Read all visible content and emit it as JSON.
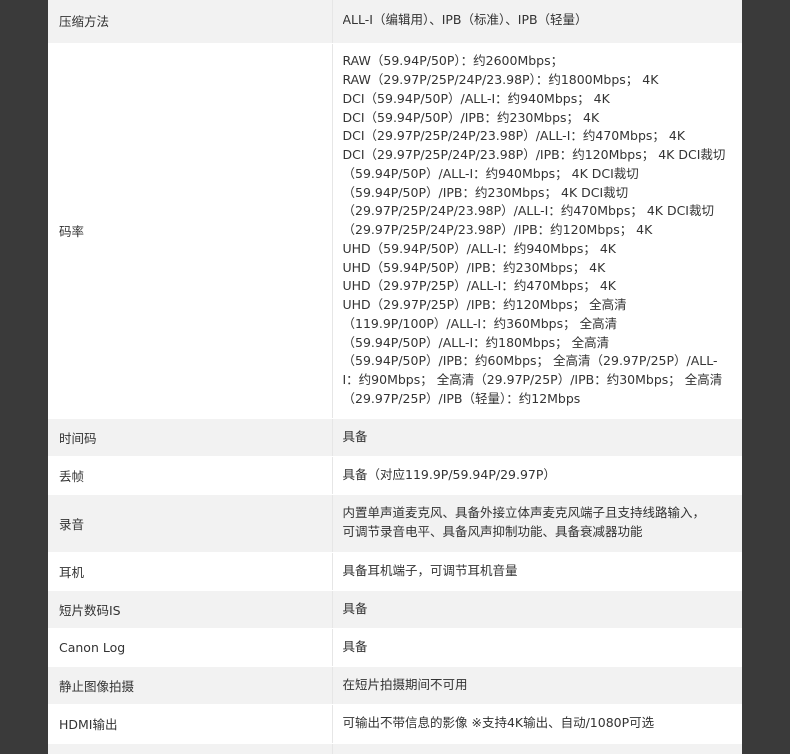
{
  "rows": [
    {
      "label": "压缩方法",
      "lines": [
        "ALL-I（编辑用）、IPB（标准）、IPB（轻量）"
      ]
    },
    {
      "label": "码率",
      "lines": [
        "RAW（59.94P/50P）：约2600Mbps；",
        "RAW（29.97P/25P/24P/23.98P）：约1800Mbps； 4K",
        "DCI（59.94P/50P）/ALL-I：约940Mbps； 4K",
        "DCI（59.94P/50P）/IPB：约230Mbps； 4K",
        "DCI（29.97P/25P/24P/23.98P）/ALL-I：约470Mbps； 4K",
        "DCI（29.97P/25P/24P/23.98P）/IPB：约120Mbps； 4K DCI裁切",
        "（59.94P/50P）/ALL-I：约940Mbps； 4K DCI裁切",
        "（59.94P/50P）/IPB：约230Mbps； 4K DCI裁切",
        "（29.97P/25P/24P/23.98P）/ALL-I：约470Mbps； 4K DCI裁切",
        "（29.97P/25P/24P/23.98P）/IPB：约120Mbps； 4K",
        "UHD（59.94P/50P）/ALL-I：约940Mbps； 4K",
        "UHD（59.94P/50P）/IPB：约230Mbps； 4K",
        "UHD（29.97P/25P）/ALL-I：约470Mbps； 4K",
        "UHD（29.97P/25P）/IPB：约120Mbps； 全高清",
        "（119.9P/100P）/ALL-I：约360Mbps； 全高清",
        "（59.94P/50P）/ALL-I：约180Mbps； 全高清",
        "（59.94P/50P）/IPB：约60Mbps； 全高清（29.97P/25P）/ALL-",
        "I：约90Mbps； 全高清（29.97P/25P）/IPB：约30Mbps； 全高清",
        "（29.97P/25P）/IPB（轻量）：约12Mbps"
      ]
    },
    {
      "label": "时间码",
      "lines": [
        "具备"
      ]
    },
    {
      "label": "丢帧",
      "lines": [
        "具备（对应119.9P/59.94P/29.97P）"
      ]
    },
    {
      "label": "录音",
      "lines": [
        "内置单声道麦克风、具备外接立体声麦克风端子且支持线路输入，",
        "可调节录音电平、具备风声抑制功能、具备衰减器功能"
      ]
    },
    {
      "label": "耳机",
      "lines": [
        "具备耳机端子，可调节耳机音量"
      ]
    },
    {
      "label": "短片数码IS",
      "lines": [
        "具备"
      ]
    },
    {
      "label": "Canon Log",
      "lines": [
        "具备"
      ]
    },
    {
      "label": "静止图像拍摄",
      "lines": [
        "在短片拍摄期间不可用"
      ]
    },
    {
      "label": "HDMI输出",
      "lines": [
        "可输出不带信息的影像 ※支持4K输出、自动/1080P可选"
      ]
    },
    {
      "label": "",
      "lines": [
        ""
      ]
    }
  ]
}
